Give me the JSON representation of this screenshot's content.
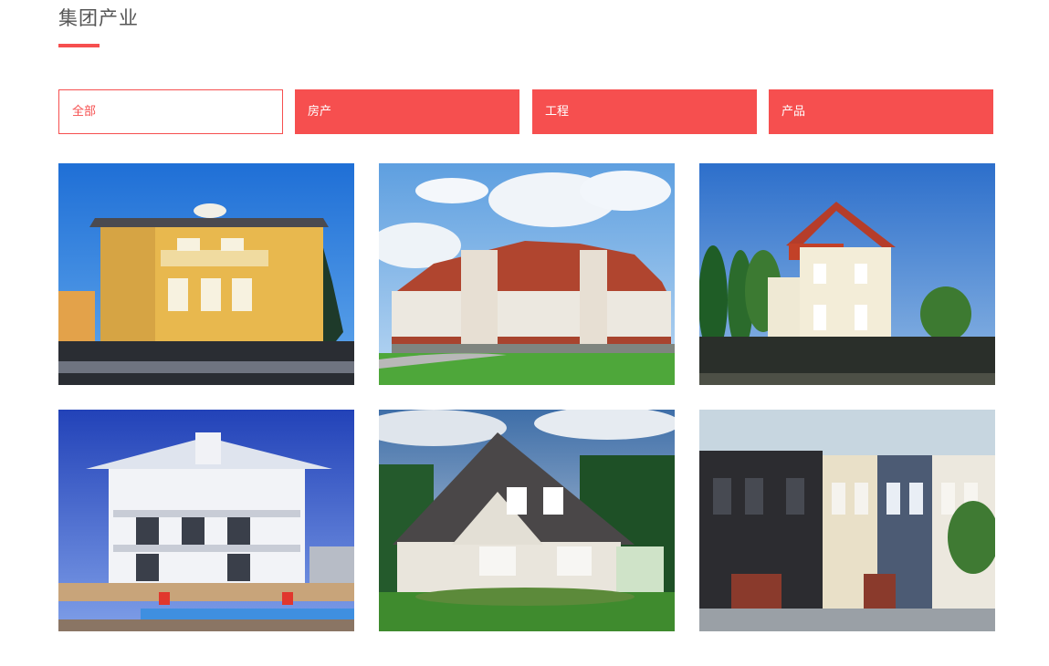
{
  "section": {
    "title": "集团产业"
  },
  "tabs": [
    {
      "label": "全部",
      "active": true
    },
    {
      "label": "房产",
      "active": false
    },
    {
      "label": "工程",
      "active": false
    },
    {
      "label": "产品",
      "active": false
    }
  ],
  "colors": {
    "accent": "#f64f4f",
    "title_text": "#555555",
    "background": "#ffffff"
  },
  "gallery": [
    {
      "subject": "yellow villa with balcony"
    },
    {
      "subject": "red-roofed historic building"
    },
    {
      "subject": "cream house with red roof"
    },
    {
      "subject": "white colonial house with pool"
    },
    {
      "subject": "brick house with dark roof"
    },
    {
      "subject": "row of victorian townhouses"
    }
  ]
}
